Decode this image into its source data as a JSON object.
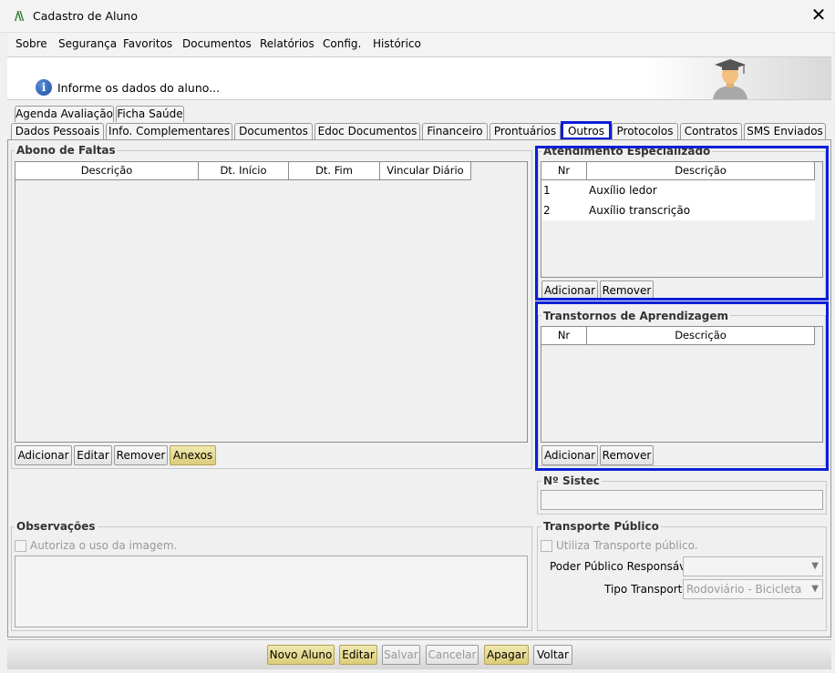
{
  "window": {
    "title": "Cadastro de Aluno",
    "logo": "/\\\\"
  },
  "menu": [
    "Sobre",
    "Segurança",
    "Favoritos",
    "Documentos",
    "Relatórios",
    "Config.",
    "Histórico"
  ],
  "header": {
    "info_text": "Informe os dados do aluno..."
  },
  "tabs_row1": [
    "Agenda Avaliação",
    "Ficha Saúde"
  ],
  "tabs_row2": [
    "Dados Pessoais",
    "Info. Complementares",
    "Documentos",
    "Edoc Documentos",
    "Financeiro",
    "Prontuários",
    "Outros",
    "Protocolos",
    "Contratos",
    "SMS Enviados"
  ],
  "active_tab": "Outros",
  "abono": {
    "label": "Abono de Faltas",
    "columns": [
      "Descrição",
      "Dt. Início",
      "Dt. Fim",
      "Vincular Diário"
    ],
    "buttons": {
      "add": "Adicionar",
      "edit": "Editar",
      "remove": "Remover",
      "attach": "Anexos"
    }
  },
  "atendimento": {
    "label": "Atendimento Especializado",
    "columns": [
      "Nr",
      "Descrição"
    ],
    "rows": [
      {
        "nr": "1",
        "descricao": "Auxílio ledor"
      },
      {
        "nr": "2",
        "descricao": "Auxílio transcrição"
      }
    ],
    "buttons": {
      "add": "Adicionar",
      "remove": "Remover"
    }
  },
  "transtornos": {
    "label": "Transtornos de Aprendizagem",
    "columns": [
      "Nr",
      "Descrição"
    ],
    "buttons": {
      "add": "Adicionar",
      "remove": "Remover"
    }
  },
  "sistec": {
    "label": "Nº Sistec",
    "value": ""
  },
  "observacoes": {
    "label": "Observações",
    "checkbox": "Autoriza o uso da imagem.",
    "text": ""
  },
  "transporte": {
    "label": "Transporte Público",
    "checkbox": "Utiliza Transporte público.",
    "poder_label": "Poder Público Responsável:",
    "poder_value": "",
    "tipo_label": "Tipo Transporte:",
    "tipo_value": "Rodoviário - Bicicleta"
  },
  "footer": {
    "novo": "Novo Aluno",
    "editar": "Editar",
    "salvar": "Salvar",
    "cancelar": "Cancelar",
    "apagar": "Apagar",
    "voltar": "Voltar"
  },
  "colors": {
    "highlight": "#0a1fd6",
    "yellow_button": "#e6db94"
  }
}
